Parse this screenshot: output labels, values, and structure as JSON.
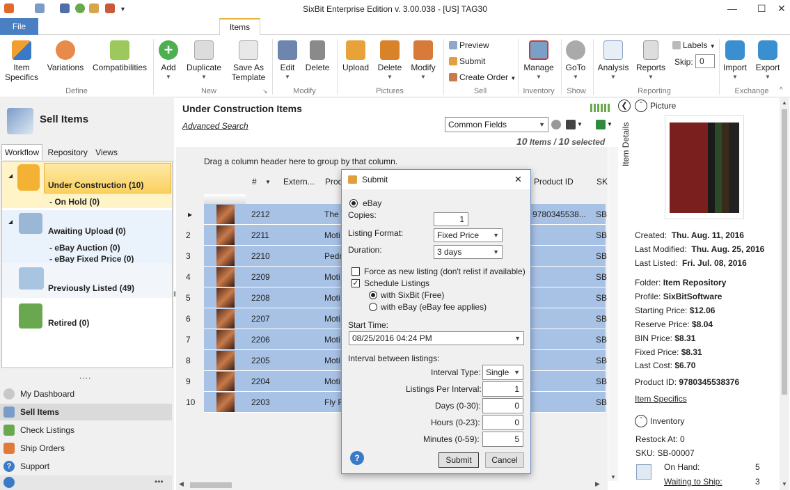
{
  "window": {
    "title": "SixBit Enterprise Edition v. 3.00.038 - [US] TAG30",
    "min": "—",
    "max": "☐",
    "close": "✕"
  },
  "tabs": {
    "file": "File",
    "items": "Items"
  },
  "ribbon": {
    "define": {
      "label": "Define",
      "item_specifics": "Item\nSpecifics",
      "variations": "Variations",
      "compatibilities": "Compatibilities"
    },
    "new": {
      "label": "New",
      "add": "Add",
      "duplicate": "Duplicate",
      "save_as_template": "Save As\nTemplate"
    },
    "modify": {
      "label": "Modify",
      "edit": "Edit",
      "delete": "Delete"
    },
    "pictures": {
      "label": "Pictures",
      "upload": "Upload",
      "delete": "Delete",
      "modify": "Modify"
    },
    "sell": {
      "label": "Sell",
      "preview": "Preview",
      "submit": "Submit",
      "create_order": "Create Order"
    },
    "inventory": {
      "label": "Inventory",
      "manage": "Manage"
    },
    "show": {
      "label": "Show",
      "goto": "GoTo"
    },
    "reporting": {
      "label": "Reporting",
      "analysis": "Analysis",
      "reports": "Reports",
      "labels": "Labels",
      "skip": "Skip:",
      "skip_value": "0"
    },
    "exchange": {
      "label": "Exchange",
      "import": "Import",
      "export": "Export"
    }
  },
  "left": {
    "title": "Sell Items",
    "tabs": [
      "Workflow",
      "Repository",
      "Views"
    ],
    "workflow": {
      "under_construction": "Under Construction  (10)",
      "on_hold": "- On Hold  (0)",
      "awaiting_upload": "Awaiting Upload  (0)",
      "ebay_auction": "- eBay Auction  (0)",
      "ebay_fixed": "- eBay Fixed Price  (0)",
      "previously_listed": "Previously Listed  (49)",
      "retired": "Retired  (0)"
    },
    "grip": "....",
    "nav": [
      "My Dashboard",
      "Sell Items",
      "Check Listings",
      "Ship Orders",
      "Support"
    ],
    "more": "•••"
  },
  "center": {
    "title": "Under Construction Items",
    "advanced_search": "Advanced Search",
    "field_set": "Common Fields",
    "items_count": "10",
    "items_word": "Items",
    "selected_sep": "/",
    "selected_count": "10",
    "selected_word": "selected",
    "group_hint": "Drag a column header here to group by that column.",
    "columns": {
      "num": "#",
      "extern": "Extern...",
      "prod": "Prod",
      "product_id": "Product ID",
      "sku": "SK"
    },
    "rows": [
      {
        "n": "",
        "id": "2212",
        "p": "The",
        "pid": "9780345538...",
        "sku": "SB"
      },
      {
        "n": "2",
        "id": "2211",
        "p": "Moti",
        "pid": "",
        "sku": "SB"
      },
      {
        "n": "3",
        "id": "2210",
        "p": "Pedr",
        "pid": "",
        "sku": "SB"
      },
      {
        "n": "4",
        "id": "2209",
        "p": "Moti",
        "pid": "",
        "sku": "SB"
      },
      {
        "n": "5",
        "id": "2208",
        "p": "Moti",
        "pid": "",
        "sku": "SB"
      },
      {
        "n": "6",
        "id": "2207",
        "p": "Moti",
        "pid": "",
        "sku": "SB"
      },
      {
        "n": "7",
        "id": "2206",
        "p": "Moti",
        "pid": "",
        "sku": "SB"
      },
      {
        "n": "8",
        "id": "2205",
        "p": "Moti",
        "pid": "",
        "sku": "SB"
      },
      {
        "n": "9",
        "id": "2204",
        "p": "Moti",
        "pid": "",
        "sku": "SB"
      },
      {
        "n": "10",
        "id": "2203",
        "p": "Fly R",
        "pid": "",
        "sku": "SB"
      }
    ]
  },
  "right": {
    "picture_label": "Picture",
    "item_details_tab": "Item Details",
    "created_label": "Created:",
    "created": "Thu. Aug. 11, 2016",
    "modified_label": "Last Modified:",
    "modified": "Thu. Aug. 25, 2016",
    "listed_label": "Last Listed:",
    "listed": "Fri. Jul. 08, 2016",
    "folder_label": "Folder:",
    "folder": "Item Repository",
    "profile_label": "Profile:",
    "profile": "SixBitSoftware",
    "start_label": "Starting Price:",
    "start": "$12.06",
    "reserve_label": "Reserve Price:",
    "reserve": "$8.04",
    "bin_label": "BIN Price:",
    "bin": "$8.31",
    "fixed_label": "Fixed Price:",
    "fixed": "$8.31",
    "cost_label": "Last Cost:",
    "cost": "$6.70",
    "product_label": "Product ID:",
    "product": "9780345538376",
    "item_specifics": "Item Specifics",
    "inventory": "Inventory",
    "restock": "Restock At:  0",
    "sku": "SKU:  SB-00007",
    "on_hand_label": "On Hand:",
    "on_hand": "5",
    "waiting_label": "Waiting to Ship:",
    "waiting": "3"
  },
  "dialog": {
    "title": "Submit",
    "close": "✕",
    "ebay": "eBay",
    "copies_label": "Copies:",
    "copies": "1",
    "format_label": "Listing Format:",
    "format": "Fixed Price",
    "duration_label": "Duration:",
    "duration": "3 days",
    "force_label": "Force as new listing (don't relist if available)",
    "schedule_label": "Schedule Listings",
    "with_sixbit": "with SixBit (Free)",
    "with_ebay": "with eBay (eBay fee applies)",
    "start_time_label": "Start Time:",
    "start_time": "08/25/2016 04:24 PM",
    "interval_label": "Interval between listings:",
    "interval_type_label": "Interval Type:",
    "interval_type": "Single",
    "per_interval_label": "Listings Per Interval:",
    "per_interval": "1",
    "days_label": "Days (0-30):",
    "days": "0",
    "hours_label": "Hours (0-23):",
    "hours": "0",
    "minutes_label": "Minutes (0-59):",
    "minutes": "5",
    "help": "?",
    "submit": "Submit",
    "cancel": "Cancel"
  },
  "colors": {
    "accent": "#4a7fc3",
    "selected_row": "#a8c2e6",
    "workflow_highlight": "#fbe08a",
    "tab_accent": "#e8b13a"
  }
}
